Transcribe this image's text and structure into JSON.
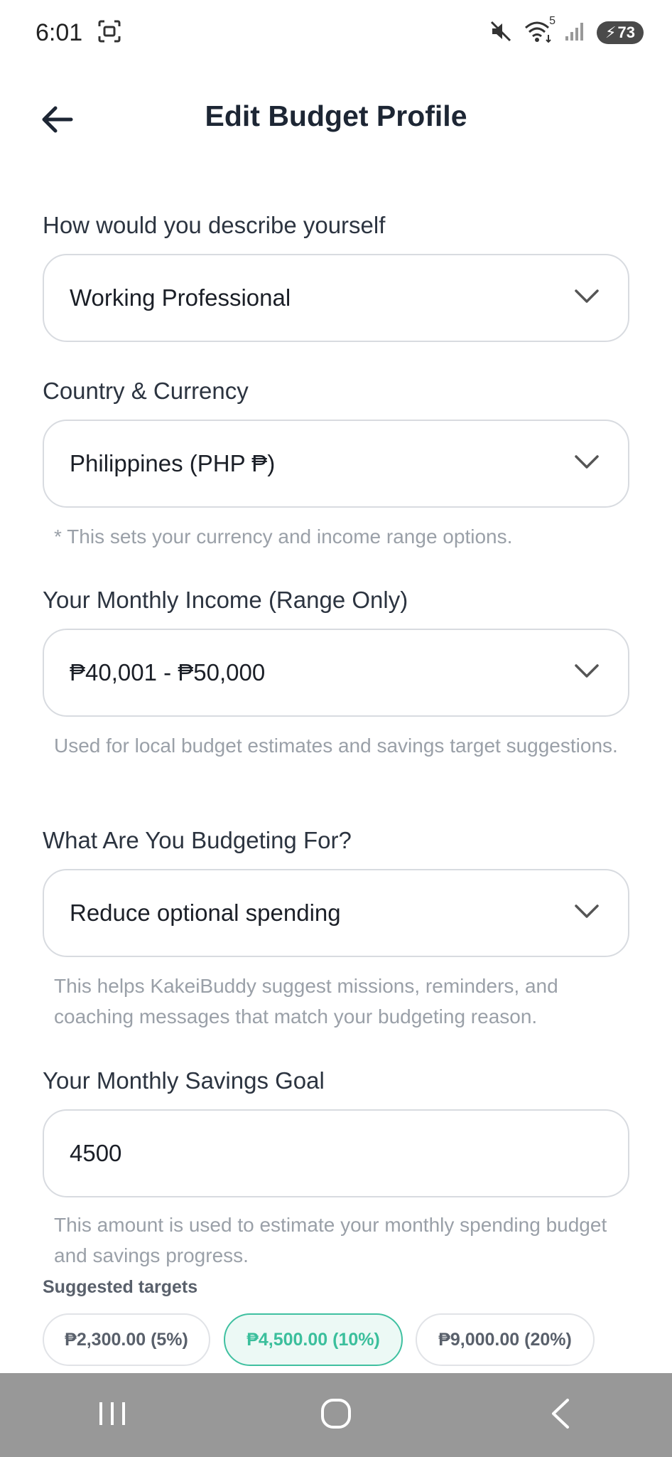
{
  "status_bar": {
    "time": "6:01",
    "battery": "73",
    "wifi_badge": "5"
  },
  "header": {
    "title": "Edit Budget Profile"
  },
  "form": {
    "describe": {
      "label": "How would you describe yourself",
      "value": "Working Professional"
    },
    "country": {
      "label": "Country & Currency",
      "value": "Philippines (PHP ₱)",
      "hint": "* This sets your currency and income range options."
    },
    "income": {
      "label": "Your Monthly Income (Range Only)",
      "value": "₱40,001 - ₱50,000",
      "hint": "Used for local budget estimates and savings target suggestions."
    },
    "purpose": {
      "label": "What Are You Budgeting For?",
      "value": "Reduce optional spending",
      "hint": "This helps KakeiBuddy suggest missions, reminders, and coaching messages that match your budgeting reason."
    },
    "savings": {
      "label": "Your Monthly Savings Goal",
      "value": "4500",
      "hint": "This amount is used to estimate your monthly spending budget and savings progress."
    },
    "suggested": {
      "label": "Suggested targets",
      "chips": [
        "₱2,300.00 (5%)",
        "₱4,500.00 (10%)",
        "₱9,000.00 (20%)"
      ],
      "selected_index": 1
    }
  },
  "colors": {
    "accent": "#3fc0a0",
    "nav_bar": "#989898"
  }
}
